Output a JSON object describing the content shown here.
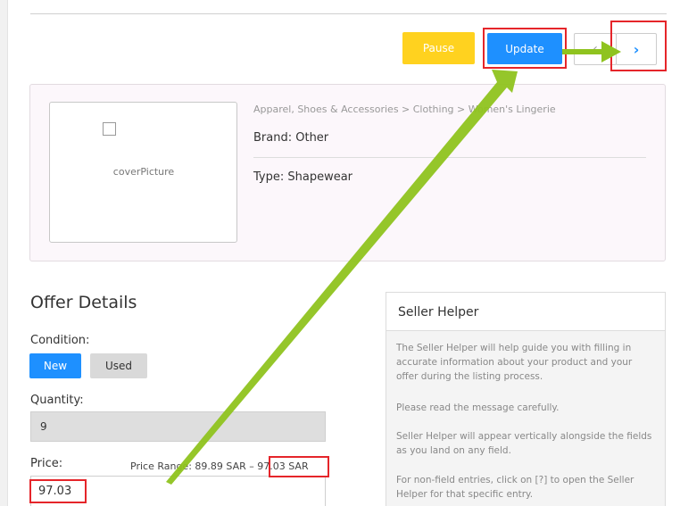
{
  "toolbar": {
    "pause_label": "Pause",
    "update_label": "Update",
    "prev_glyph": "‹",
    "next_glyph": "›"
  },
  "product": {
    "cover_label": "coverPicture",
    "category_path": "Apparel, Shoes & Accessories > Clothing > Women's Lingerie",
    "brand": "Brand: Other",
    "type": "Type: Shapewear"
  },
  "offer": {
    "title": "Offer Details",
    "condition_label": "Condition:",
    "condition_new": "New",
    "condition_used": "Used",
    "condition_selected": "New",
    "quantity_label": "Quantity:",
    "quantity_value": "9",
    "price_label": "Price:",
    "price_range_prefix": "Price Range: 89.89 SAR –",
    "price_range_max": "97.03 SAR",
    "price_value": "97.03"
  },
  "helper": {
    "title": "Seller Helper",
    "p1": "The Seller Helper will help guide you with filling in accurate information about your product and your offer during the listing process.",
    "p2": "Please read the message carefully.",
    "p3": "Seller Helper will appear vertically alongside the fields as you land on any field.",
    "p4": "For non-field entries, click on [?] to open the Seller Helper for that specific entry."
  },
  "colors": {
    "accent": "#1e90ff",
    "pause": "#ffd21f",
    "highlight": "#e5252a",
    "annotation_arrow": "#8fc31f"
  },
  "icons": {
    "prev": "chevron-left-icon",
    "next": "chevron-right-icon",
    "checkbox": "checkbox-icon"
  }
}
